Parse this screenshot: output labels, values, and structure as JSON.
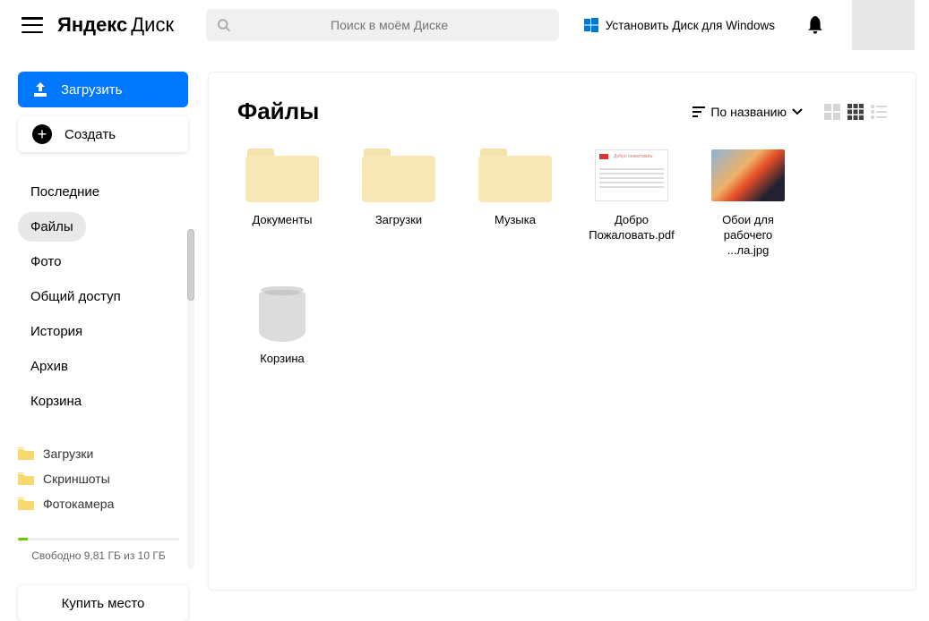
{
  "header": {
    "logo_main": "Яндекс",
    "logo_sub": "Диск",
    "search_placeholder": "Поиск в моём Диске",
    "install_label": "Установить Диск для Windows"
  },
  "sidebar": {
    "upload_label": "Загрузить",
    "create_label": "Создать",
    "nav": [
      {
        "label": "Последние",
        "active": false
      },
      {
        "label": "Файлы",
        "active": true
      },
      {
        "label": "Фото",
        "active": false
      },
      {
        "label": "Общий доступ",
        "active": false
      },
      {
        "label": "История",
        "active": false
      },
      {
        "label": "Архив",
        "active": false
      },
      {
        "label": "Корзина",
        "active": false
      }
    ],
    "folders": [
      {
        "label": "Загрузки"
      },
      {
        "label": "Скриншоты"
      },
      {
        "label": "Фотокамера"
      }
    ],
    "storage_text": "Свободно 9,81 ГБ из 10 ГБ",
    "buy_label": "Купить место"
  },
  "content": {
    "title": "Файлы",
    "sort_label": "По названию",
    "items": [
      {
        "type": "folder",
        "label": "Документы"
      },
      {
        "type": "folder",
        "label": "Загрузки"
      },
      {
        "type": "folder",
        "label": "Музыка"
      },
      {
        "type": "pdf",
        "label": "Добро Пожаловать.pdf"
      },
      {
        "type": "image",
        "label": "Обои для рабочего ...ла.jpg"
      },
      {
        "type": "trash",
        "label": "Корзина"
      }
    ]
  }
}
